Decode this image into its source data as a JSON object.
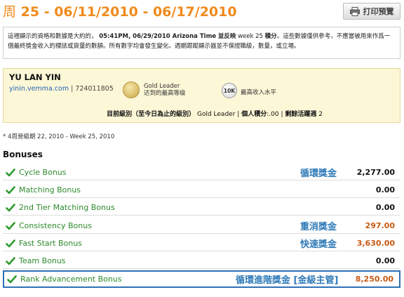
{
  "header": {
    "week_prefix": "周",
    "title": "25 - 06/11/2010 - 06/17/2010",
    "print_label": "打印預覽"
  },
  "disclaimer": {
    "before": "這裡顯示的資格和數據是大約的，",
    "time_bold": "05:41PM, 06/29/2010 Arizona Time",
    "reflect_bold": "並反映",
    "week_text": "week 25",
    "points_bold": "積分",
    "after": "。這些數據僅供參考，不應當被用來作爲一個最終獎金收入的標誌或貨量的數額。所有數字均會發生變化。週期跟蹤顯示器並不保證職級，數量，或立場。"
  },
  "member": {
    "name": "YU LAN YIN",
    "site": "yinin.vemma.com",
    "separator": "|",
    "id": "724011805",
    "gold_title": "Gold Leader",
    "gold_sub": "达到的最高等级",
    "badge_10k": "10K",
    "highest_income": "最高收入水平",
    "current_rank_label": "目前級別（至今日為止的級別）",
    "current_rank_value": "Gold Leader",
    "pipe": "|",
    "personal_points_label": "個人積分",
    "personal_points_value": ":.00",
    "remaining_label": "剩餘活躍週",
    "remaining_value": "2"
  },
  "weeks_note": "* 4周晉級期 22, 2010 - Week 25, 2010",
  "bonuses": {
    "heading": "Bonuses",
    "rows": [
      {
        "label": "Cycle Bonus",
        "chinese": "循環獎金",
        "amount": "2,277.00"
      },
      {
        "label": "Matching Bonus",
        "chinese": "",
        "amount": "0.00"
      },
      {
        "label": "2nd Tier Matching Bonus",
        "chinese": "",
        "amount": "0.00"
      },
      {
        "label": "Consistency Bonus",
        "chinese": "重消獎金",
        "amount": "297.00"
      },
      {
        "label": "Fast Start Bonus",
        "chinese": "快速獎金",
        "amount": "3,630.00"
      },
      {
        "label": "Team Bonus",
        "chinese": "",
        "amount": "0.00"
      },
      {
        "label": "Rank Advancement Bonus",
        "chinese": "循環進階獎金 [金級主管]",
        "amount": "8,250.00"
      }
    ]
  },
  "colors": {
    "title_orange": "#f08a1c",
    "bonus_green": "#2d8a2d",
    "chinese_blue": "#2f7ab8",
    "amount_orange": "#c85a14",
    "member_bg": "#fcf7d7",
    "highlight_border": "#2f6fb5"
  },
  "icons": {
    "print": "printer-icon",
    "check": "check-icon",
    "gold": "gold-medal-icon",
    "tenk": "10k-badge-icon"
  }
}
